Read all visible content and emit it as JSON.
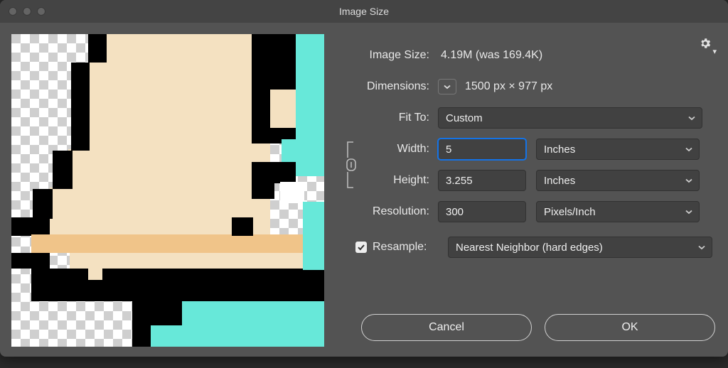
{
  "title": "Image Size",
  "image_size": {
    "label": "Image Size:",
    "value": "4.19M (was 169.4K)"
  },
  "dimensions": {
    "label": "Dimensions:",
    "value": "1500 px  ×  977 px"
  },
  "fit_to": {
    "label": "Fit To:",
    "value": "Custom"
  },
  "width": {
    "label": "Width:",
    "value": "5",
    "unit": "Inches"
  },
  "height": {
    "label": "Height:",
    "value": "3.255",
    "unit": "Inches"
  },
  "resolution": {
    "label": "Resolution:",
    "value": "300",
    "unit": "Pixels/Inch"
  },
  "resample": {
    "label": "Resample:",
    "value": "Nearest Neighbor (hard edges)",
    "checked": true
  },
  "buttons": {
    "cancel": "Cancel",
    "ok": "OK"
  }
}
